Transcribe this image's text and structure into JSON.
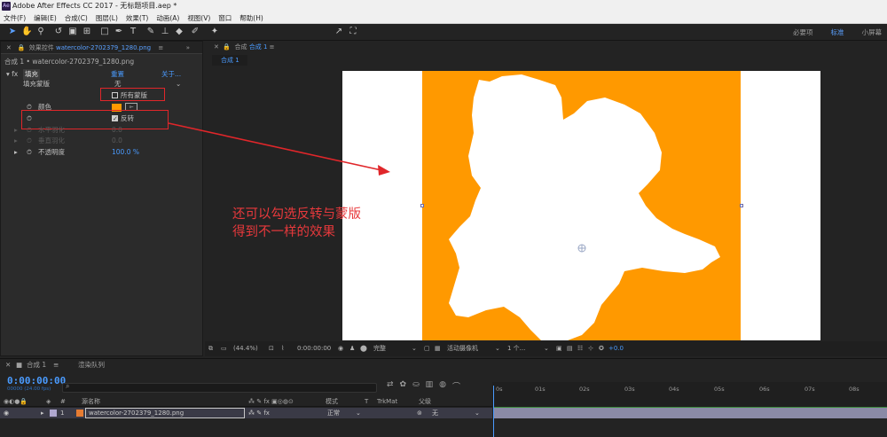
{
  "window": {
    "title": "Adobe After Effects CC 2017 - 无标题项目.aep *",
    "logo": "Ae"
  },
  "menu": [
    "文件(F)",
    "编辑(E)",
    "合成(C)",
    "图层(L)",
    "效果(T)",
    "动画(A)",
    "视图(V)",
    "窗口",
    "帮助(H)"
  ],
  "toolbar": {
    "align_label": "对齐",
    "workspaces": [
      "必要项",
      "标准",
      "小屏幕"
    ]
  },
  "effect_controls": {
    "tab_label": "效果控件",
    "tab_file": "watercolor-2702379_1280.png",
    "breadcrumb": "合成 1 • watercolor-2702379_1280.png",
    "fx_name": "填充",
    "reset": "重置",
    "about": "关于...",
    "fill_mask_label": "填充蒙版",
    "fill_mask_value": "无",
    "all_masks_label": "所有蒙版",
    "color_label": "颜色",
    "color_value": "#ff9900",
    "invert_label": "反转",
    "h_feather_label": "水平羽化",
    "h_feather_value": "0.0",
    "v_feather_label": "垂直羽化",
    "v_feather_value": "0.0",
    "opacity_label": "不透明度",
    "opacity_value": "100.0 %"
  },
  "viewer": {
    "tab_label": "合成",
    "tab_name": "合成 1",
    "subtab": "合成 1",
    "zoom": "(44.4%)",
    "timecode": "0:00:00:00",
    "resolution": "完整",
    "camera": "活动摄像机",
    "views": "1 个...",
    "exposure": "+0.0"
  },
  "annotation": {
    "line1": "还可以勾选反转与蒙版",
    "line2": "得到不一样的效果"
  },
  "timeline": {
    "tab_comp": "合成 1",
    "tab_render": "渲染队列",
    "time": "0:00:00:00",
    "fps": "00000 (24.00 fps)",
    "col_source": "源名称",
    "col_mode": "模式",
    "col_t": "T",
    "col_trkmat": "TrkMat",
    "col_parent": "父级",
    "layer_index": "1",
    "layer_name": "watercolor-2702379_1280.png",
    "layer_mode": "正常",
    "layer_parent": "无",
    "ruler_ticks": [
      "0s",
      "01s",
      "02s",
      "03s",
      "04s",
      "05s",
      "06s",
      "07s",
      "08s"
    ]
  }
}
